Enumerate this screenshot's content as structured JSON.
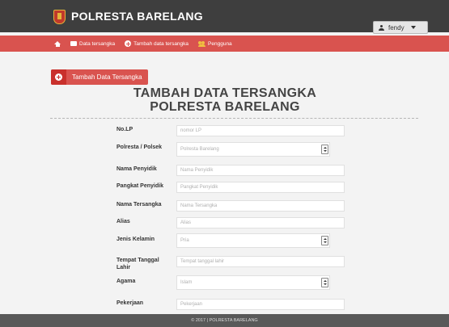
{
  "header": {
    "brand": "POLRESTA BARELANG",
    "user": "fendy"
  },
  "nav": {
    "items": [
      {
        "label": "Data tersangka"
      },
      {
        "label": "Tambah data tersangka"
      },
      {
        "label": "Pengguna"
      }
    ]
  },
  "add_button_label": "Tambah Data Tersangka",
  "title_line1": "TAMBAH DATA TERSANGKA",
  "title_line2": "POLRESTA BARELANG",
  "form": {
    "no_lp": {
      "label": "No.LP",
      "placeholder": "nomor LP"
    },
    "polresta": {
      "label": "Polresta / Polsek",
      "value": "Polresta Barelang"
    },
    "nama_penyidik": {
      "label": "Nama Penyidik",
      "placeholder": "Nama Penyidik"
    },
    "pangkat_penyidik": {
      "label": "Pangkat Penyidik",
      "placeholder": "Pangkat Penyidik"
    },
    "nama_tersangka": {
      "label": "Nama Tersangka",
      "placeholder": "Nama Tersangka"
    },
    "alias": {
      "label": "Alias",
      "placeholder": "Alias"
    },
    "jenis_kelamin": {
      "label": "Jenis Kelamin",
      "value": "Pria"
    },
    "tempat_tanggal_lahir": {
      "label": "Tempat Tanggal Lahir",
      "placeholder": "Tempat tanggal lahir"
    },
    "agama": {
      "label": "Agama",
      "value": "Islam"
    },
    "pekerjaan": {
      "label": "Pekerjaan",
      "placeholder": "Pekerjaan"
    }
  },
  "footer": "© 2017 | POLRESTA BARELANG",
  "colors": {
    "topbar": "#3e3e3e",
    "navbar": "#d9534f",
    "footer": "#595959"
  },
  "icons": [
    "shield-logo-icon",
    "user-icon",
    "chevron-down-icon",
    "home-icon",
    "folder-icon",
    "plus-circle-icon",
    "users-icon",
    "select-arrows-icon"
  ]
}
